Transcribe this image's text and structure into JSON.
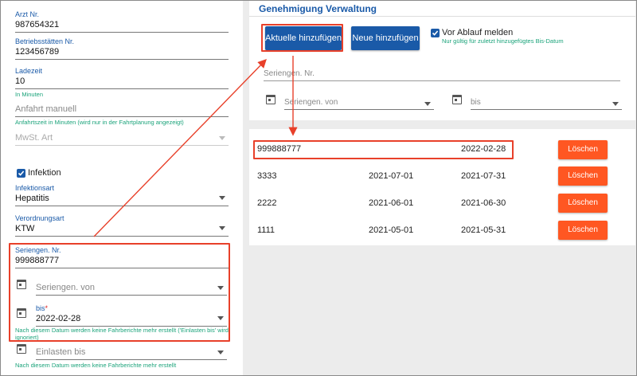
{
  "left": {
    "arzt_nr": {
      "label": "Arzt Nr.",
      "value": "987654321"
    },
    "betriebsstaetten_nr": {
      "label": "Betriebsstätten Nr.",
      "value": "123456789"
    },
    "ladezeit": {
      "label": "Ladezeit",
      "value": "10",
      "hint": "In Minuten"
    },
    "anfahrt": {
      "placeholder": "Anfahrt manuell",
      "hint": "Anfahrtszeit in Minuten (wird nur in der Fahrtplanung angezeigt)"
    },
    "mwst": {
      "placeholder": "MwSt. Art"
    },
    "infektion": {
      "label": "Infektion",
      "checked": true
    },
    "infektionsart": {
      "label": "Infektionsart",
      "value": "Hepatitis"
    },
    "verordnungsart": {
      "label": "Verordnungsart",
      "value": "KTW"
    },
    "seriengen_nr": {
      "label": "Seriengen. Nr.",
      "value": "999888777"
    },
    "seriengen_von": {
      "placeholder": "Seriengen. von"
    },
    "bis": {
      "label": "bis",
      "required_mark": "*",
      "value": "2022-02-28",
      "hint": "Nach diesem Datum werden keine Fahrberichte mehr erstellt ('Einlasten bis' wird ignoriert)"
    },
    "einlasten_bis": {
      "placeholder": "Einlasten bis",
      "hint": "Nach diesem Datum werden keine Fahrberichte mehr erstellt"
    }
  },
  "right": {
    "title": "Genehmigung Verwaltung",
    "buttons": {
      "aktuelle": "Aktuelle hinzufügen",
      "neue": "Neue hinzufügen"
    },
    "vor_ablauf": {
      "label": "Vor Ablauf melden",
      "hint": "Nur gültig für zuletzt hinzugefügtes Bis-Datum",
      "checked": true
    },
    "seriengen_nr_placeholder": "Seriengen. Nr.",
    "seriengen_von_placeholder": "Seriengen. von",
    "bis_placeholder": "bis",
    "delete_label": "Löschen",
    "rows": [
      {
        "nr": "999888777",
        "von": "",
        "bis": "2022-02-28"
      },
      {
        "nr": "3333",
        "von": "2021-07-01",
        "bis": "2021-07-31"
      },
      {
        "nr": "2222",
        "von": "2021-06-01",
        "bis": "2021-06-30"
      },
      {
        "nr": "1111",
        "von": "2021-05-01",
        "bis": "2021-05-31"
      }
    ]
  },
  "colors": {
    "primary": "#1a5aa8",
    "delete": "#ff5722",
    "highlight": "#e8402a",
    "hint": "#1aa37a"
  }
}
